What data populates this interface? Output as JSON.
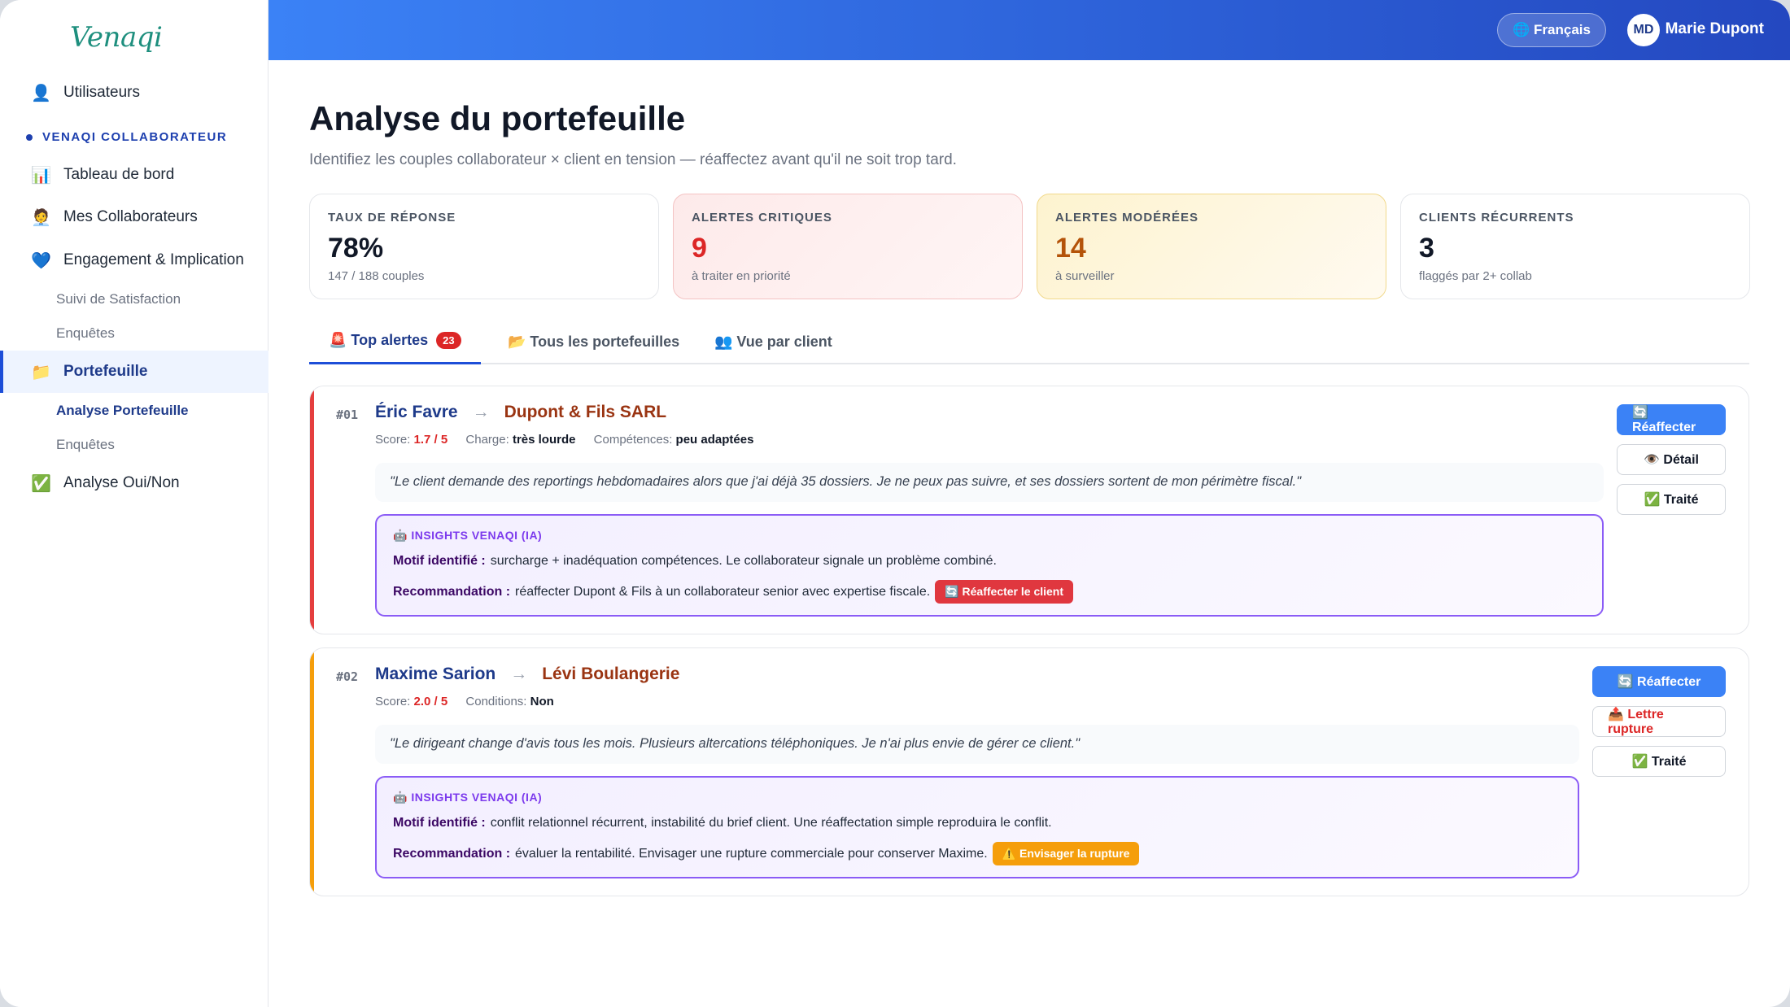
{
  "sidebar": {
    "logo": "Venaqi",
    "users": {
      "icon": "👤",
      "label": "Utilisateurs"
    },
    "section": "VENAQI COLLABORATEUR",
    "items": [
      {
        "icon": "📊",
        "label": "Tableau de bord"
      },
      {
        "icon": "🧑‍💼",
        "label": "Mes Collaborateurs"
      },
      {
        "icon": "💙",
        "label": "Engagement & Implication"
      },
      {
        "icon": "📁",
        "label": "Portefeuille"
      },
      {
        "icon": "✅",
        "label": "Analyse Oui/Non"
      }
    ],
    "engagement_subs": [
      "Suivi de Satisfaction",
      "Enquêtes"
    ],
    "portfolio_subs": [
      "Analyse Portefeuille",
      "Enquêtes"
    ]
  },
  "header": {
    "language": "🌐 Français",
    "avatar": "MD",
    "user": "Marie Dupont"
  },
  "page": {
    "title": "Analyse du portefeuille",
    "subtitle": "Identifiez les couples collaborateur × client en tension — réaffectez avant qu'il ne soit trop tard."
  },
  "kpis": [
    {
      "label": "TAUX DE RÉPONSE",
      "value": "78%",
      "sub": "147 / 188 couples"
    },
    {
      "label": "ALERTES CRITIQUES",
      "value": "9",
      "sub": "à traiter en priorité"
    },
    {
      "label": "ALERTES MODÉRÉES",
      "value": "14",
      "sub": "à surveiller"
    },
    {
      "label": "CLIENTS RÉCURRENTS",
      "value": "3",
      "sub": "flaggés par 2+ collab"
    }
  ],
  "tabs": {
    "top": "🚨 Top alertes",
    "top_badge": "23",
    "all": "📂 Tous les portefeuilles",
    "client": "👥 Vue par client"
  },
  "alerts": [
    {
      "rank": "#01",
      "collaborator": "Éric Favre",
      "arrow": "→",
      "client": "Dupont & Fils SARL",
      "score_label": "Score:",
      "score": "1.7 / 5",
      "m1_label": "Charge:",
      "m1_value": "très lourde",
      "m2_label": "Compétences:",
      "m2_value": "peu adaptées",
      "quote": "\"Le client demande des reportings hebdomadaires alors que j'ai déjà 35 dossiers. Je ne peux pas suivre, et ses dossiers sortent de mon périmètre fiscal.\"",
      "insight_title": "🤖 INSIGHTS VENAQI (IA)",
      "motif_label": "Motif identifié :",
      "motif": "surcharge + inadéquation compétences. Le collaborateur signale un problème combiné.",
      "reco_label": "Recommandation :",
      "reco": "réaffecter Dupont & Fils à un collaborateur senior avec expertise fiscale.",
      "reco_action": "🔄 Réaffecter le client",
      "actions": [
        "🔄 Réaffecter",
        "👁️ Détail",
        "✅ Traité"
      ],
      "accent": "#e53e3e"
    },
    {
      "rank": "#02",
      "collaborator": "Maxime Sarion",
      "arrow": "→",
      "client": "Lévi Boulangerie",
      "score_label": "Score:",
      "score": "2.0 / 5",
      "m1_label": "Conditions:",
      "m1_value": "Non",
      "quote": "\"Le dirigeant change d'avis tous les mois. Plusieurs altercations téléphoniques. Je n'ai plus envie de gérer ce client.\"",
      "insight_title": "🤖 INSIGHTS VENAQI (IA)",
      "motif_label": "Motif identifié :",
      "motif": "conflit relationnel récurrent, instabilité du brief client. Une réaffectation simple reproduira le conflit.",
      "reco_label": "Recommandation :",
      "reco": "évaluer la rentabilité. Envisager une rupture commerciale pour conserver Maxime.",
      "reco_action": "⚠️ Envisager la rupture",
      "actions": [
        "🔄 Réaffecter",
        "📤 Lettre rupture",
        "✅ Traité"
      ],
      "accent": "#f59e0b"
    }
  ]
}
